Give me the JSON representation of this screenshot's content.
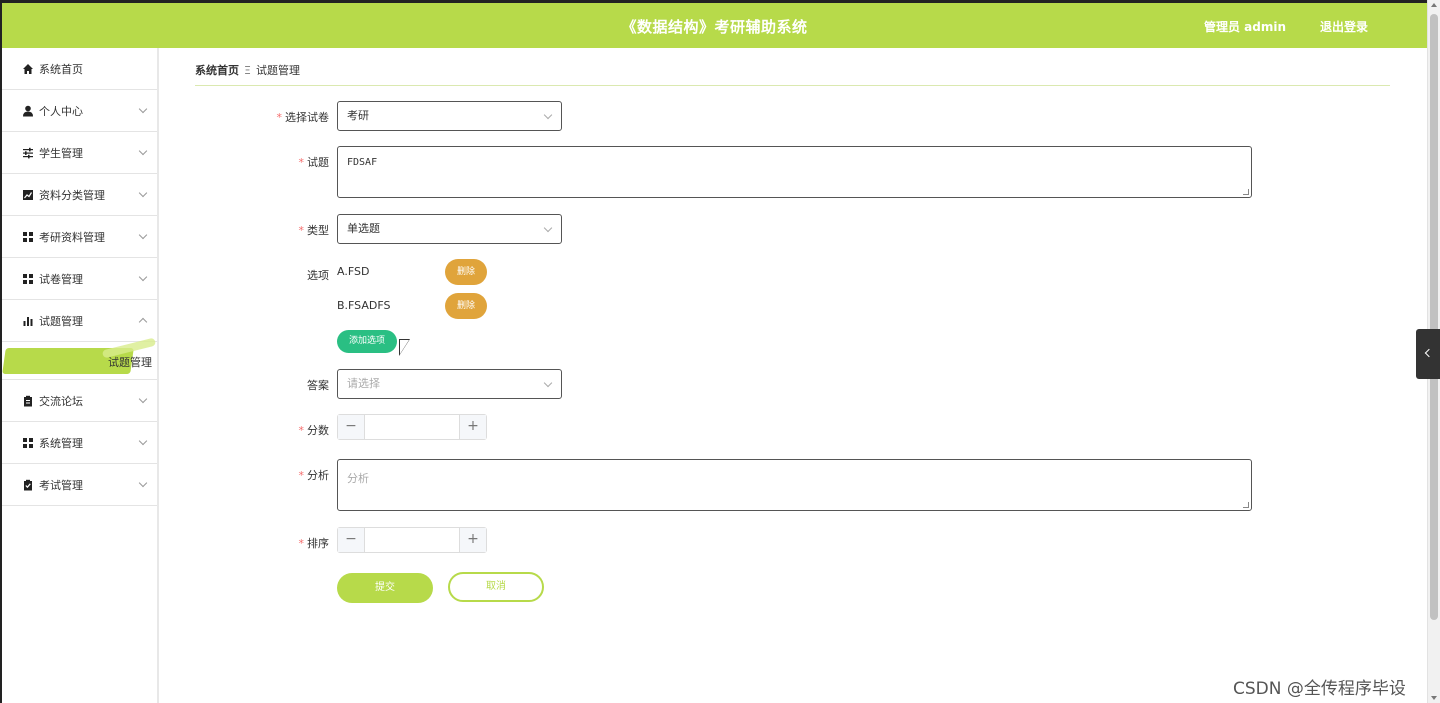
{
  "header": {
    "title": "《数据结构》考研辅助系统",
    "user": "管理员 admin",
    "logout": "退出登录",
    "bg_color": "#b7da4a"
  },
  "sidebar": {
    "items": [
      {
        "label": "系统首页",
        "icon": "home-icon"
      },
      {
        "label": "个人中心",
        "icon": "user-icon"
      },
      {
        "label": "学生管理",
        "icon": "sliders-icon"
      },
      {
        "label": "资料分类管理",
        "icon": "chart-line-icon"
      },
      {
        "label": "考研资料管理",
        "icon": "grid-icon"
      },
      {
        "label": "试卷管理",
        "icon": "grid-icon"
      },
      {
        "label": "试题管理",
        "icon": "bar-chart-icon"
      },
      {
        "label": "交流论坛",
        "icon": "clipboard-icon"
      },
      {
        "label": "系统管理",
        "icon": "grid-icon"
      },
      {
        "label": "考试管理",
        "icon": "clipboard-check-icon"
      }
    ],
    "submenu_active": "试题管理"
  },
  "breadcrumb": {
    "home": "系统首页",
    "separator": "Ξ",
    "current": "试题管理"
  },
  "form": {
    "paper": {
      "label": "选择试卷",
      "value": "考研"
    },
    "question": {
      "label": "试题",
      "value": "FDSAF"
    },
    "type": {
      "label": "类型",
      "value": "单选题"
    },
    "options": {
      "label": "选项",
      "items": [
        "A.FSD",
        "B.FSADFS"
      ],
      "delete_label": "删除",
      "add_label": "添加选项"
    },
    "answer": {
      "label": "答案",
      "placeholder": "请选择"
    },
    "score": {
      "label": "分数",
      "value": ""
    },
    "analysis": {
      "label": "分析",
      "placeholder": "分析"
    },
    "sort": {
      "label": "排序",
      "value": ""
    },
    "submit": "提交",
    "cancel": "取消"
  },
  "watermark": "CSDN @全传程序毕设"
}
